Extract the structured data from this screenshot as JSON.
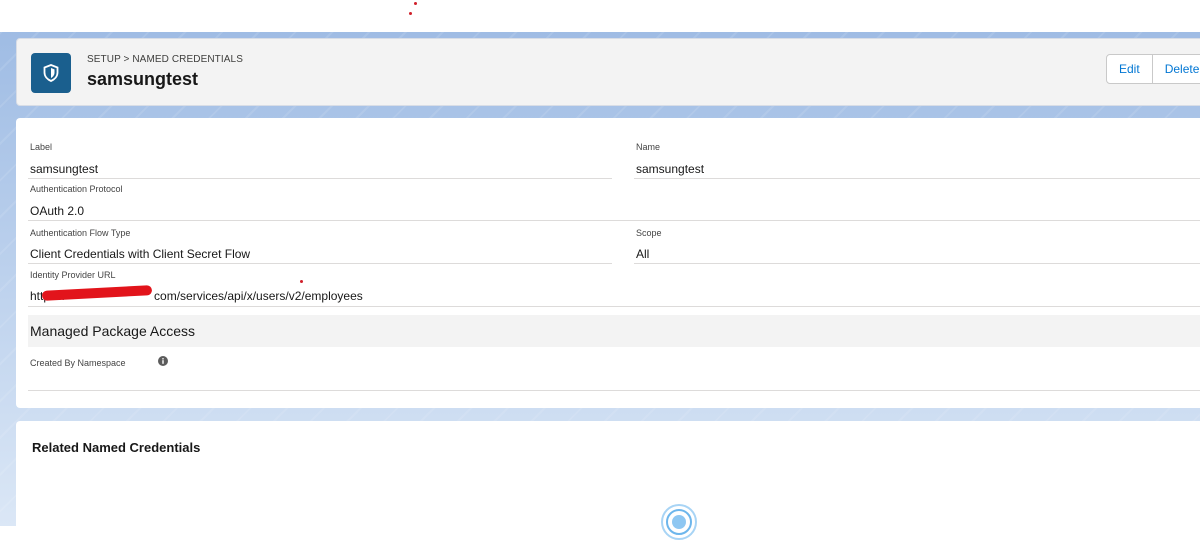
{
  "header": {
    "breadcrumb": "SETUP > NAMED CREDENTIALS",
    "title": "samsungtest",
    "buttons": {
      "edit": "Edit",
      "delete": "Delete"
    }
  },
  "fields": {
    "label": {
      "label": "Label",
      "value": "samsungtest"
    },
    "name": {
      "label": "Name",
      "value": "samsungtest"
    },
    "auth_protocol": {
      "label": "Authentication Protocol",
      "value": "OAuth 2.0"
    },
    "auth_flow": {
      "label": "Authentication Flow Type",
      "value": "Client Credentials with Client Secret Flow"
    },
    "scope": {
      "label": "Scope",
      "value": "All"
    },
    "idp_url": {
      "label": "Identity Provider URL",
      "value_prefix": "https://",
      "value_suffix": "com/services/api/x/users/v2/employees"
    }
  },
  "managed_package": {
    "heading": "Managed Package Access",
    "created_by_label": "Created By Namespace"
  },
  "related": {
    "title": "Related Named Credentials"
  },
  "icons": {
    "object": "shield-icon",
    "info": "info-icon",
    "loading": "spinner-icon"
  },
  "colors": {
    "brand": "#1a5f8e",
    "link": "#0176d3",
    "redaction": "#e2141b"
  }
}
